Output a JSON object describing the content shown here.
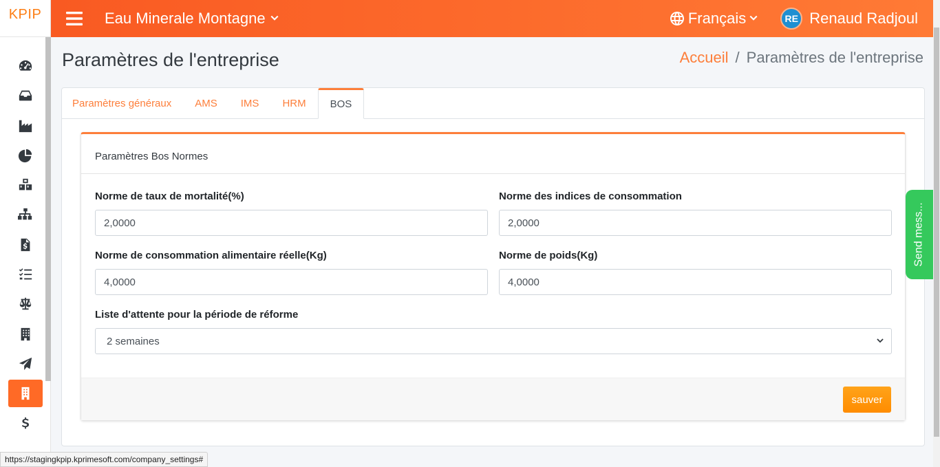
{
  "brand": "KPIP",
  "topbar": {
    "company": "Eau Minerale Montagne",
    "language": "Français",
    "user_initials": "RE",
    "user_name": "Renaud Radjoul"
  },
  "sidebar": {
    "items": [
      {
        "icon": "dashboard-icon"
      },
      {
        "icon": "inbox-icon"
      },
      {
        "icon": "industry-icon"
      },
      {
        "icon": "pie-chart-icon"
      },
      {
        "icon": "cubes-icon"
      },
      {
        "icon": "sitemap-icon"
      },
      {
        "icon": "invoice-icon"
      },
      {
        "icon": "tasks-icon"
      },
      {
        "icon": "balance-scale-icon"
      },
      {
        "icon": "building-icon"
      },
      {
        "icon": "send-icon"
      },
      {
        "icon": "company-icon",
        "active": true
      },
      {
        "icon": "dollar-icon"
      }
    ]
  },
  "page": {
    "title": "Paramètres de l'entreprise",
    "breadcrumb": {
      "home": "Accueil",
      "separator": "/",
      "current": "Paramètres de l'entreprise"
    }
  },
  "tabs": [
    {
      "label": "Paramètres généraux"
    },
    {
      "label": "AMS"
    },
    {
      "label": "IMS"
    },
    {
      "label": "HRM"
    },
    {
      "label": "BOS",
      "active": true
    }
  ],
  "bos": {
    "header": "Paramètres Bos Normes",
    "fields": {
      "mortality_label": "Norme de taux de mortalité(%)",
      "mortality_value": "2,0000",
      "consumption_index_label": "Norme des indices de consommation",
      "consumption_index_value": "2,0000",
      "food_consumption_label": "Norme de consommation alimentaire réelle(Kg)",
      "food_consumption_value": "4,0000",
      "weight_label": "Norme de poids(Kg)",
      "weight_value": "4,0000",
      "waitlist_label": "Liste d'attente pour la période de réforme",
      "waitlist_value": "2 semaines"
    },
    "save_label": "sauver"
  },
  "feedback_label": "Send mess...",
  "status_url": "https://stagingkpip.kprimesoft.com/company_settings#",
  "colors": {
    "accent": "#fd7e3a",
    "topbar": "#f95a22",
    "save": "#ff8c00",
    "feedback": "#35c95c"
  }
}
